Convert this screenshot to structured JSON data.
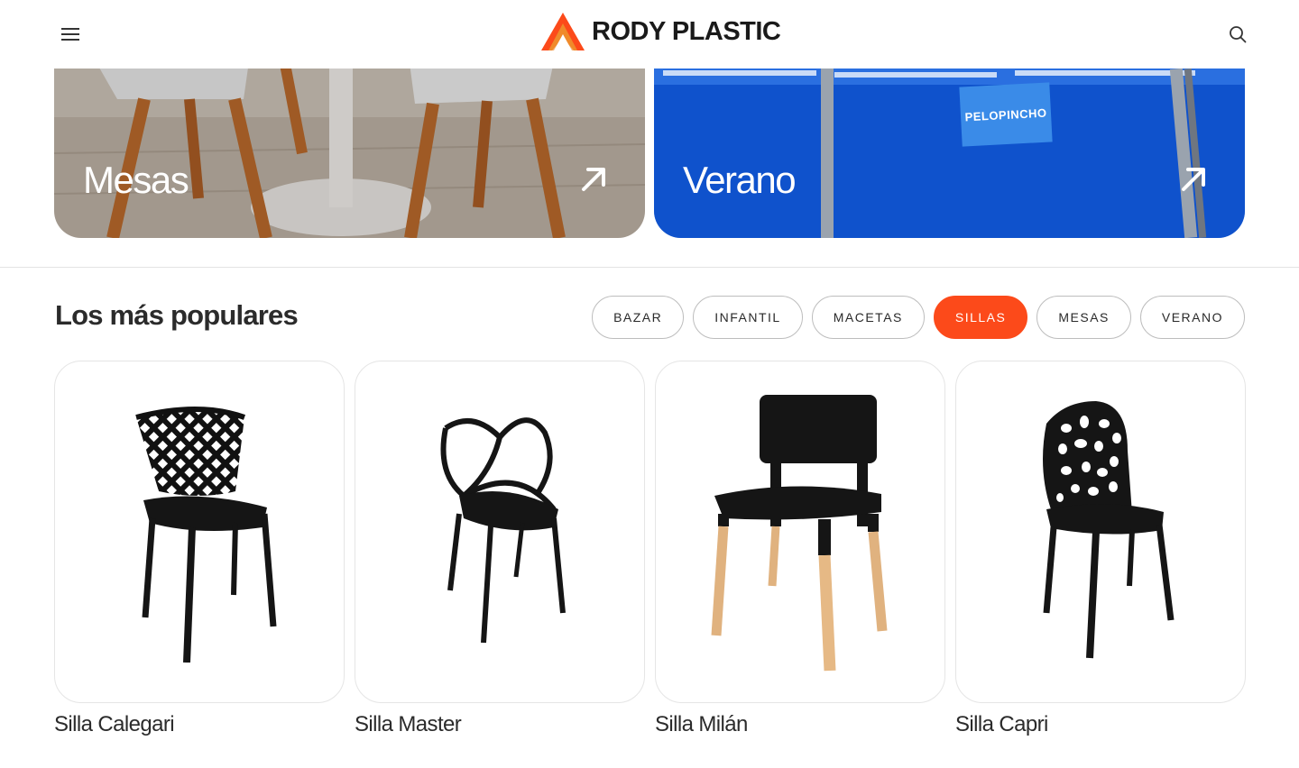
{
  "brand": {
    "name": "RODY PLASTIC",
    "accent": "#fc4a1a"
  },
  "header": {
    "menu_icon": "menu-icon",
    "search_icon": "search-icon"
  },
  "banners": [
    {
      "label": "Mesas",
      "icon": "arrow-up-right-icon"
    },
    {
      "label": "Verano",
      "icon": "arrow-up-right-icon",
      "pool_sign": "PELOPINCHO"
    }
  ],
  "popular": {
    "title": "Los más populares",
    "filters": [
      "BAZAR",
      "INFANTIL",
      "MACETAS",
      "SILLAS",
      "MESAS",
      "VERANO"
    ],
    "active_filter": "SILLAS",
    "products": [
      {
        "name": "Silla Calegari"
      },
      {
        "name": "Silla Master"
      },
      {
        "name": "Silla Milán"
      },
      {
        "name": "Silla Capri"
      }
    ]
  }
}
